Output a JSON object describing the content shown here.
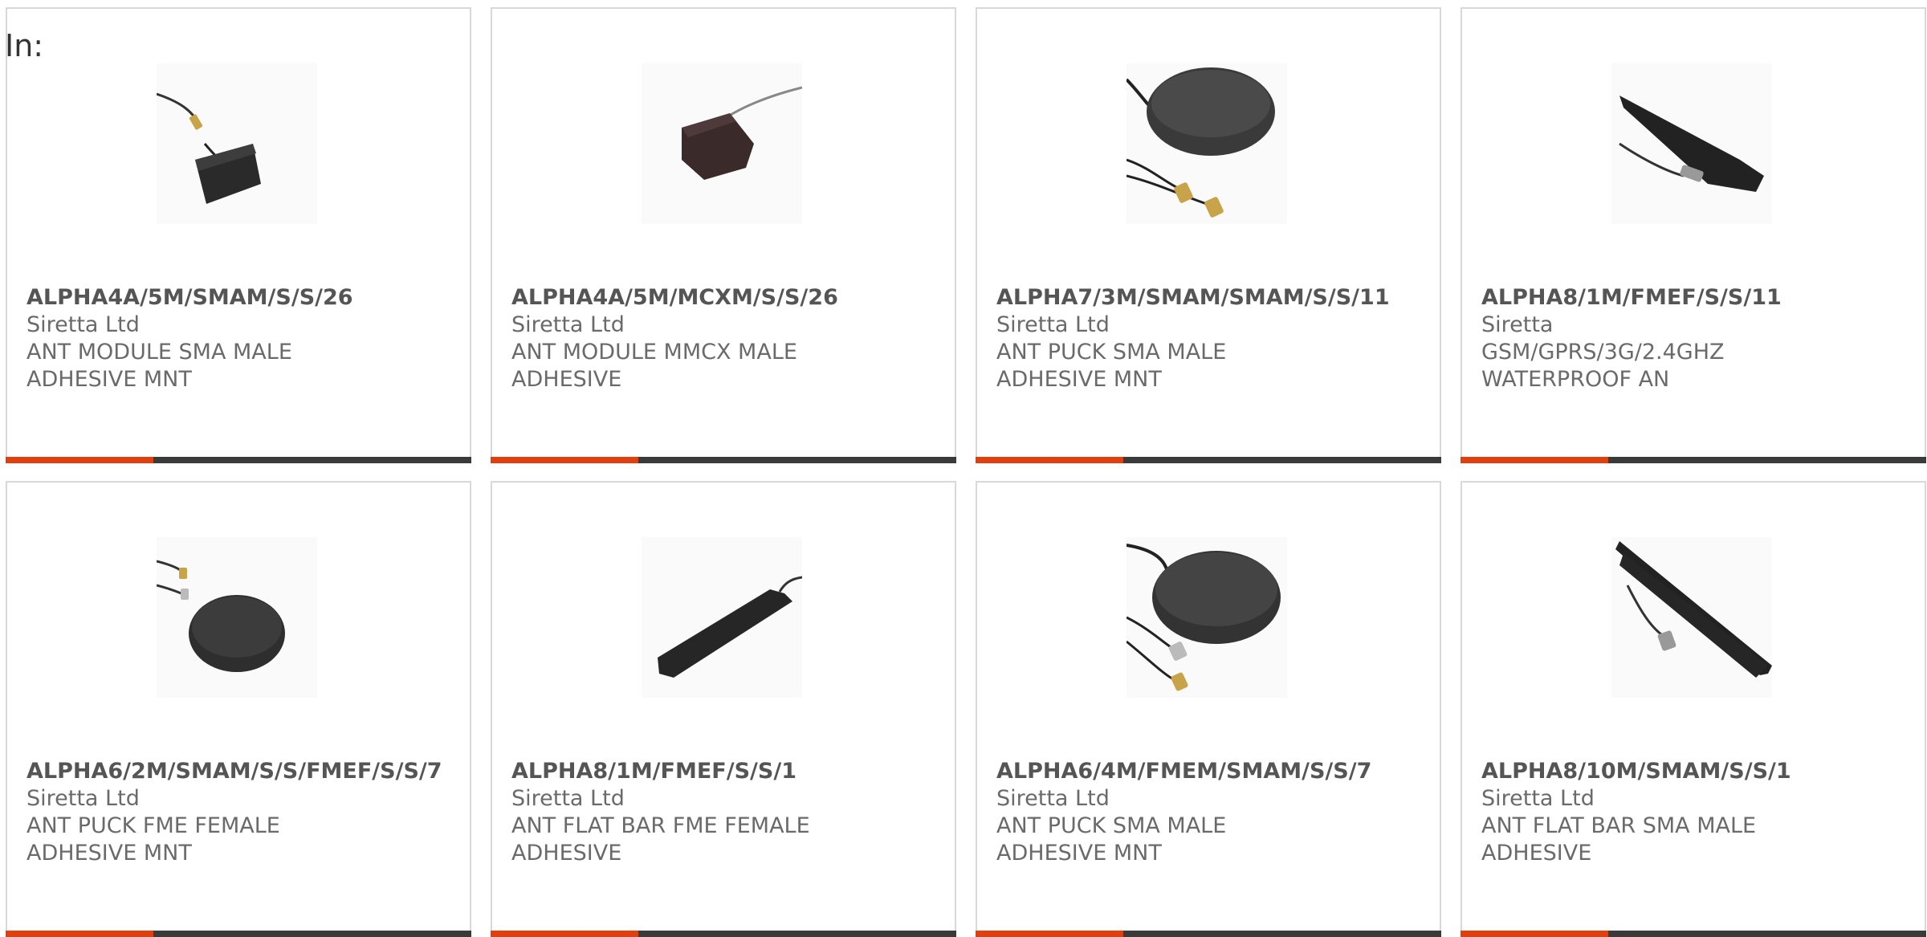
{
  "filter_label": "In:",
  "accent_color": "#e1400e",
  "bar_color": "#3a3a3a",
  "products": [
    {
      "part_number": "ALPHA4A/5M/SMAM/S/S/26",
      "manufacturer": "Siretta Ltd",
      "description": "ANT MODULE SMA MALE ADHESIVE MNT",
      "image_icon": "patch-antenna-sma-icon"
    },
    {
      "part_number": "ALPHA4A/5M/MCXM/S/S/26",
      "manufacturer": "Siretta Ltd",
      "description": "ANT MODULE MMCX MALE ADHESIVE",
      "image_icon": "patch-antenna-mcx-icon"
    },
    {
      "part_number": "ALPHA7/3M/SMAM/SMAM/S/S/11",
      "manufacturer": "Siretta Ltd",
      "description": "ANT PUCK SMA MALE ADHESIVE MNT",
      "image_icon": "puck-antenna-icon"
    },
    {
      "part_number": "ALPHA8/1M/FMEF/S/S/11",
      "manufacturer": "Siretta",
      "description": "GSM/GPRS/3G/2.4GHZ WATERPROOF AN",
      "image_icon": "flat-bar-antenna-icon"
    },
    {
      "part_number": "ALPHA6/2M/SMAM/S/S/FMEF/S/S/7",
      "manufacturer": "Siretta Ltd",
      "description": "ANT PUCK FME FEMALE ADHESIVE MNT",
      "image_icon": "puck-antenna-icon"
    },
    {
      "part_number": "ALPHA8/1M/FMEF/S/S/1",
      "manufacturer": "Siretta Ltd",
      "description": "ANT FLAT BAR FME FEMALE ADHESIVE",
      "image_icon": "flat-bar-antenna-icon"
    },
    {
      "part_number": "ALPHA6/4M/FMEM/SMAM/S/S/7",
      "manufacturer": "Siretta Ltd",
      "description": "ANT PUCK SMA MALE ADHESIVE MNT",
      "image_icon": "puck-antenna-icon"
    },
    {
      "part_number": "ALPHA8/10M/SMAM/S/S/1",
      "manufacturer": "Siretta Ltd",
      "description": "ANT FLAT BAR SMA MALE ADHESIVE",
      "image_icon": "flat-bar-antenna-icon"
    }
  ]
}
